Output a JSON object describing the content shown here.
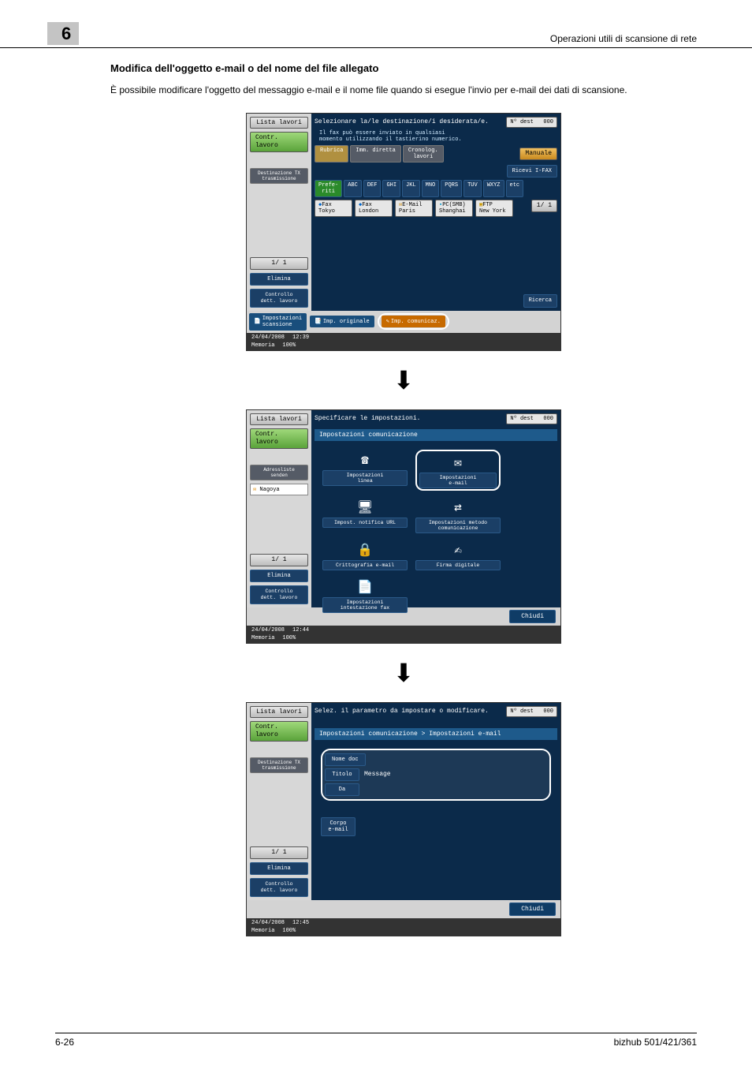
{
  "header": {
    "chapter": "6",
    "right": "Operazioni utili di scansione di rete"
  },
  "section": {
    "title": "Modifica dell'oggetto e-mail o del nome del file allegato",
    "body": "È possibile modificare l'oggetto del messaggio e-mail e il nome file quando si esegue l'invio per e-mail dei dati di scansione."
  },
  "screen1": {
    "topmsg": "Selezionare la/le destinazione/i desiderata/e.",
    "dest_label": "Nº dest",
    "dest_count": "000",
    "hint": "Il fax può essere inviato in qualsiasi\nmomento utilizzando il tastierino numerico.",
    "tabs": [
      "Rubrica",
      "Imm. diretta",
      "Cronolog.\nlavori"
    ],
    "manuale": "Manuale",
    "ricevi": "Ricevi I-FAX",
    "filter_keys": [
      "Prefe-\nriti",
      "ABC",
      "DEF",
      "GHI",
      "JKL",
      "MNO",
      "PQRS",
      "TUV",
      "WXYZ",
      "etc"
    ],
    "dest_buttons": [
      {
        "type": "Fax",
        "label": "Tokyo"
      },
      {
        "type": "Fax",
        "label": "London"
      },
      {
        "type": "E-Mail",
        "label": "Paris"
      },
      {
        "type": "PC(SMB)",
        "label": "Shanghai"
      },
      {
        "type": "FTP",
        "label": "New York"
      }
    ],
    "pager": "1/  1",
    "left": {
      "lista": "Lista lavori",
      "contr": "Contr.\nlavoro",
      "dest": "Destinazione TX\ntrasmissione",
      "pager": "1/    1",
      "elimina": "Elimina",
      "controllo": "Controllo\ndett. lavoro"
    },
    "footbtns": [
      "Impostazioni\nscansione",
      "Imp. originale",
      "Imp. comunicaz."
    ],
    "ricerca": "Ricerca",
    "status": {
      "date": "24/04/2008",
      "time": "12:39",
      "mem": "Memoria",
      "pct": "100%"
    }
  },
  "screen2": {
    "topmsg": "Specificare le impostazioni.",
    "dest_label": "Nº dest",
    "dest_count": "000",
    "panel": "Impostazioni comunicazione",
    "left": {
      "lista": "Lista lavori",
      "contr": "Contr.\nlavoro",
      "addr": "Adressliste senden",
      "nagoya": "Nagoya",
      "pager": "1/    1",
      "elimina": "Elimina",
      "controllo": "Controllo\ndett. lavoro"
    },
    "options": [
      "Impostazioni\nlinea",
      "Impostazioni\ne-mail",
      "Impost. notifica URL",
      "Impostazioni metodo\ncomunicazione",
      "Crittografia e-mail",
      "Firma digitale",
      "Impostazioni\nintestazione fax"
    ],
    "chiudi": "Chiudi",
    "status": {
      "date": "24/04/2008",
      "time": "12:44",
      "mem": "Memoria",
      "pct": "100%"
    }
  },
  "screen3": {
    "topmsg": "Selez. il parametro da impostare o modificare.",
    "dest_label": "Nº dest",
    "dest_count": "000",
    "panel": "Impostazioni comunicazione > Impostazioni e-mail",
    "left": {
      "lista": "Lista lavori",
      "contr": "Contr.\nlavoro",
      "dest": "Destinazione TX\ntrasmissione",
      "pager": "1/    1",
      "elimina": "Elimina",
      "controllo": "Controllo\ndett. lavoro"
    },
    "form": {
      "nome": "Nome doc",
      "titolo": "Titolo",
      "titolo_val": "Message",
      "da": "Da",
      "corpo": "Corpo\ne-mail"
    },
    "chiudi": "Chiudi",
    "status": {
      "date": "24/04/2008",
      "time": "12:45",
      "mem": "Memoria",
      "pct": "100%"
    }
  },
  "pagefooter": {
    "left": "6-26",
    "right": "bizhub 501/421/361"
  }
}
